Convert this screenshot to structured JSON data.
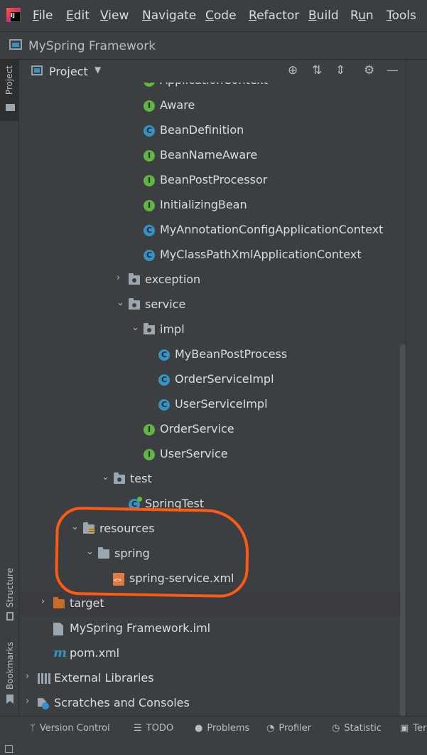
{
  "menu": {
    "logo_icon": "intellij-idea-icon",
    "items": [
      "File",
      "Edit",
      "View",
      "Navigate",
      "Code",
      "Refactor",
      "Build",
      "Run",
      "Tools"
    ],
    "mnemonics": [
      "F",
      "E",
      "V",
      "N",
      "C",
      "R",
      "B",
      "u",
      "T"
    ]
  },
  "navbar": {
    "project_name": "MySpring Framework",
    "chevron": "›"
  },
  "left_strip": {
    "project_tab": "Project",
    "structure_tab": "Structure",
    "bookmarks_tab": "Bookmarks"
  },
  "tool_window": {
    "title": "Project",
    "dropdown": "▼",
    "buttons": [
      "⊕",
      "⇅",
      "⇕",
      "⚙",
      "—"
    ]
  },
  "tree": [
    {
      "label": "ApplicationContext",
      "icon": "interface-icon",
      "kind": "interface"
    },
    {
      "label": "Aware",
      "icon": "interface-icon",
      "kind": "interface"
    },
    {
      "label": "BeanDefinition",
      "icon": "class-icon",
      "kind": "class"
    },
    {
      "label": "BeanNameAware",
      "icon": "interface-icon",
      "kind": "interface"
    },
    {
      "label": "BeanPostProcessor",
      "icon": "interface-icon",
      "kind": "interface"
    },
    {
      "label": "InitializingBean",
      "icon": "interface-icon",
      "kind": "interface"
    },
    {
      "label": "MyAnnotationConfigApplicationContext",
      "icon": "class-icon",
      "kind": "class"
    },
    {
      "label": "MyClassPathXmlApplicationContext",
      "icon": "class-icon",
      "kind": "class"
    },
    {
      "label": "exception",
      "icon": "package-icon",
      "kind": "package",
      "arrow": "›"
    },
    {
      "label": "service",
      "icon": "package-icon",
      "kind": "package",
      "arrow": "⌄"
    },
    {
      "label": "impl",
      "icon": "package-icon",
      "kind": "package",
      "arrow": "⌄"
    },
    {
      "label": "MyBeanPostProcess",
      "icon": "class-icon",
      "kind": "class"
    },
    {
      "label": "OrderServiceImpl",
      "icon": "class-icon",
      "kind": "class"
    },
    {
      "label": "UserServiceImpl",
      "icon": "class-icon",
      "kind": "class"
    },
    {
      "label": "OrderService",
      "icon": "interface-icon",
      "kind": "interface"
    },
    {
      "label": "UserService",
      "icon": "interface-icon",
      "kind": "interface"
    },
    {
      "label": "test",
      "icon": "package-icon",
      "kind": "package",
      "arrow": "⌄"
    },
    {
      "label": "SpringTest",
      "icon": "test-class-icon",
      "kind": "test"
    },
    {
      "label": "resources",
      "icon": "resources-folder-icon",
      "kind": "resources",
      "arrow": "⌄"
    },
    {
      "label": "spring",
      "icon": "folder-icon",
      "kind": "folder",
      "arrow": "⌄"
    },
    {
      "label": "spring-service.xml",
      "icon": "xml-file-icon",
      "kind": "xml"
    },
    {
      "label": "target",
      "icon": "excluded-folder-icon",
      "kind": "target",
      "arrow": "›"
    },
    {
      "label": "MySpring Framework.iml",
      "icon": "iml-file-icon",
      "kind": "iml"
    },
    {
      "label": "pom.xml",
      "icon": "maven-icon",
      "kind": "pom"
    },
    {
      "label": "External Libraries",
      "icon": "libraries-icon",
      "kind": "libs",
      "arrow": "›"
    },
    {
      "label": "Scratches and Consoles",
      "icon": "scratches-icon",
      "kind": "scratch",
      "arrow": "›"
    }
  ],
  "status_bar": {
    "items": [
      {
        "label": "Version Control",
        "icon": "vcs-icon",
        "glyph": "ᛘ"
      },
      {
        "label": "TODO",
        "icon": "todo-icon",
        "glyph": "☰"
      },
      {
        "label": "Problems",
        "icon": "problems-icon",
        "glyph": "●"
      },
      {
        "label": "Profiler",
        "icon": "profiler-icon",
        "glyph": "◔"
      },
      {
        "label": "Statistic",
        "icon": "statistic-icon",
        "glyph": "◷"
      },
      {
        "label": "Ter",
        "icon": "terminal-icon",
        "glyph": "▣"
      }
    ]
  },
  "colors": {
    "annotation": "#ff5a14",
    "interface": "#62b543",
    "class": "#3592c4",
    "xml": "#e07a41",
    "excluded": "#c76b29"
  }
}
